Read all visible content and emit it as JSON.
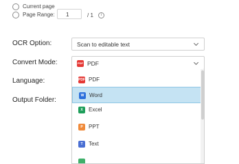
{
  "page_scope": {
    "current_page_label": "Current page",
    "page_range_label": "Page Range:",
    "range_from": "1",
    "range_to": "/ 1"
  },
  "ocr_option": {
    "label": "OCR Option:",
    "value": "Scan to editable text"
  },
  "convert_mode": {
    "label": "Convert Mode:",
    "value": "PDF",
    "options": [
      {
        "label": "PDF",
        "icon": "pdf-icon",
        "color": "#e53935"
      },
      {
        "label": "Word",
        "icon": "word-icon",
        "color": "#2b6fdb"
      },
      {
        "label": "Excel",
        "icon": "excel-icon",
        "color": "#1e9e5a"
      },
      {
        "label": "PPT",
        "icon": "ppt-icon",
        "color": "#f08a3a"
      },
      {
        "label": "Text",
        "icon": "text-icon",
        "color": "#4a6fd3"
      }
    ],
    "selected_index": 1
  },
  "language": {
    "label": "Language:"
  },
  "output_folder": {
    "label": "Output Folder:"
  },
  "colors": {
    "highlight": "#c5e3f3",
    "highlight_border": "#8ec6e5"
  }
}
